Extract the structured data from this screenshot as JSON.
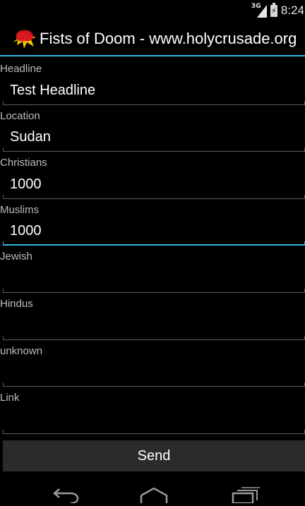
{
  "status_bar": {
    "network": "3G",
    "time": "8:24"
  },
  "action_bar": {
    "title": "Fists of Doom - www.holycrusade.org",
    "icon": "fist-icon"
  },
  "form": {
    "fields": [
      {
        "label": "Headline",
        "value": "Test Headline"
      },
      {
        "label": "Location",
        "value": "Sudan"
      },
      {
        "label": "Christians",
        "value": "1000"
      },
      {
        "label": "Muslims",
        "value": "1000"
      },
      {
        "label": "Jewish",
        "value": ""
      },
      {
        "label": "Hindus",
        "value": ""
      },
      {
        "label": "unknown",
        "value": ""
      },
      {
        "label": "Link",
        "value": ""
      }
    ],
    "send_label": "Send"
  },
  "nav_bar": {
    "back": "back-icon",
    "home": "home-icon",
    "recents": "recent-apps-icon"
  },
  "colors": {
    "accent": "#33b5e5",
    "background": "#000000",
    "button": "#2b2b2b"
  }
}
